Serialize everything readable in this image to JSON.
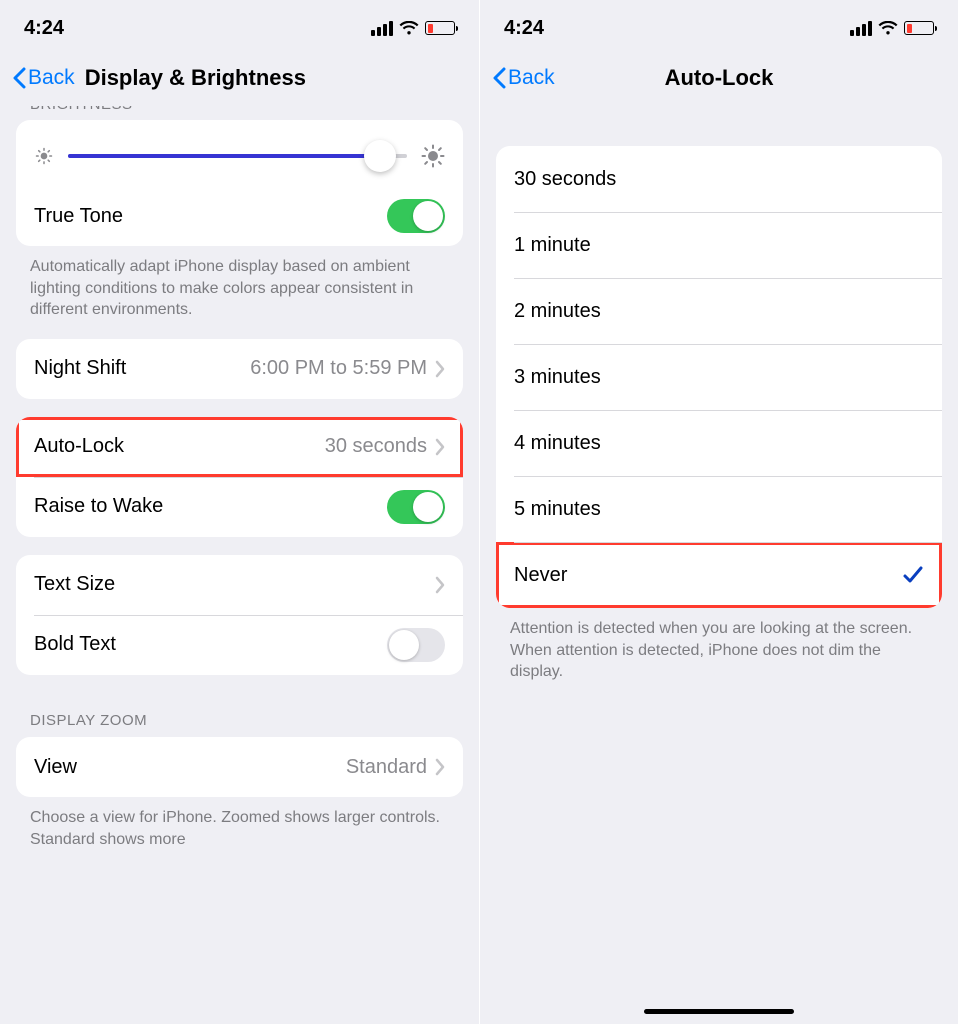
{
  "status": {
    "time": "4:24"
  },
  "left": {
    "nav": {
      "back": "Back",
      "title": "Display & Brightness"
    },
    "truncated_header": "BRIGHTNESS",
    "slider_pct": 92,
    "truetone": {
      "label": "True Tone",
      "on": true
    },
    "truetone_footer": "Automatically adapt iPhone display based on ambient lighting conditions to make colors appear consistent in different environments.",
    "nightshift": {
      "label": "Night Shift",
      "value": "6:00 PM to 5:59 PM"
    },
    "autolock": {
      "label": "Auto-Lock",
      "value": "30 seconds"
    },
    "raisetowake": {
      "label": "Raise to Wake",
      "on": true
    },
    "textsize": {
      "label": "Text Size"
    },
    "boldtext": {
      "label": "Bold Text",
      "on": false
    },
    "zoom_header": "DISPLAY ZOOM",
    "view": {
      "label": "View",
      "value": "Standard"
    },
    "zoom_footer": "Choose a view for iPhone. Zoomed shows larger controls. Standard shows more"
  },
  "right": {
    "nav": {
      "back": "Back",
      "title": "Auto-Lock"
    },
    "options": [
      {
        "label": "30 seconds",
        "selected": false
      },
      {
        "label": "1 minute",
        "selected": false
      },
      {
        "label": "2 minutes",
        "selected": false
      },
      {
        "label": "3 minutes",
        "selected": false
      },
      {
        "label": "4 minutes",
        "selected": false
      },
      {
        "label": "5 minutes",
        "selected": false
      },
      {
        "label": "Never",
        "selected": true
      }
    ],
    "footer": "Attention is detected when you are looking at the screen. When attention is detected, iPhone does not dim the display."
  }
}
